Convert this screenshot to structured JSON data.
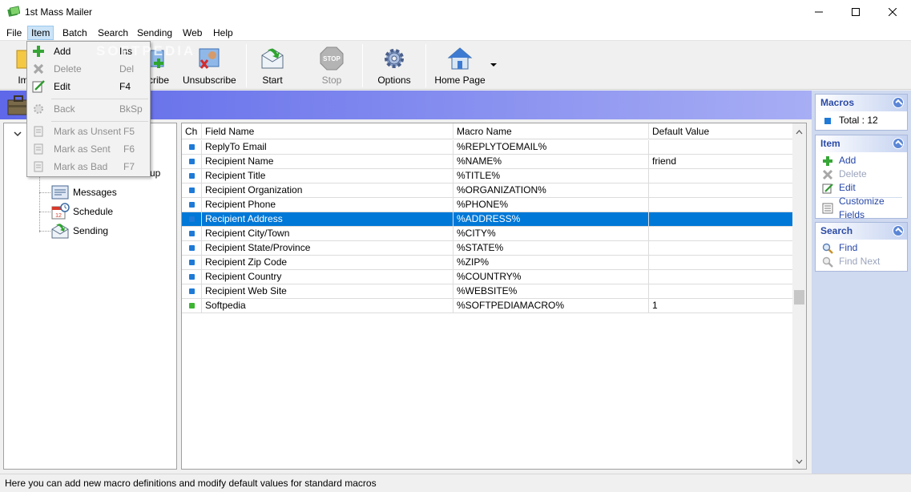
{
  "window": {
    "title": "1st Mass Mailer"
  },
  "menubar": {
    "items": [
      {
        "label": "File"
      },
      {
        "label": "Item"
      },
      {
        "label": "Batch"
      },
      {
        "label": "Search"
      },
      {
        "label": "Sending"
      },
      {
        "label": "Web"
      },
      {
        "label": "Help"
      }
    ]
  },
  "toolbar": {
    "import_label": "Im",
    "subscribe_label": "scribe",
    "unsubscribe_label": "Unsubscribe",
    "start_label": "Start",
    "stop_label": "Stop",
    "options_label": "Options",
    "homepage_label": "Home Page"
  },
  "watermark": "SOFTPEDIA",
  "item_menu": {
    "items": [
      {
        "label": "Add",
        "shortcut": "Ins",
        "icon": "add-icon",
        "enabled": true
      },
      {
        "label": "Delete",
        "shortcut": "Del",
        "icon": "delete-icon",
        "enabled": false
      },
      {
        "label": "Edit",
        "shortcut": "F4",
        "icon": "edit-icon",
        "enabled": true
      },
      {
        "label": "Back",
        "shortcut": "BkSp",
        "icon": "back-icon",
        "enabled": false
      },
      {
        "label": "Mark as Unsent",
        "shortcut": "F5",
        "icon": "mark-unsent-icon",
        "enabled": false
      },
      {
        "label": "Mark as Sent",
        "shortcut": "F6",
        "icon": "mark-sent-icon",
        "enabled": false
      },
      {
        "label": "Mark as Bad",
        "shortcut": "F7",
        "icon": "mark-bad-icon",
        "enabled": false
      }
    ]
  },
  "tree": {
    "partial_label": "up",
    "nodes": [
      {
        "label": "Messages",
        "icon": "messages-icon"
      },
      {
        "label": "Schedule",
        "icon": "schedule-icon"
      },
      {
        "label": "Sending",
        "icon": "sending-icon"
      }
    ]
  },
  "grid": {
    "columns": [
      "Ch",
      "Field Name",
      "Macro Name",
      "Default Value"
    ],
    "rows": [
      {
        "field": "ReplyTo Email",
        "macro": "%REPLYTOEMAIL%",
        "default": "",
        "mark_color": "#1e7ad6",
        "selected": false
      },
      {
        "field": "Recipient Name",
        "macro": "%NAME%",
        "default": "friend",
        "mark_color": "#1e7ad6",
        "selected": false
      },
      {
        "field": "Recipient Title",
        "macro": "%TITLE%",
        "default": "",
        "mark_color": "#1e7ad6",
        "selected": false
      },
      {
        "field": "Recipient Organization",
        "macro": "%ORGANIZATION%",
        "default": "",
        "mark_color": "#1e7ad6",
        "selected": false
      },
      {
        "field": "Recipient Phone",
        "macro": "%PHONE%",
        "default": "",
        "mark_color": "#1e7ad6",
        "selected": false
      },
      {
        "field": "Recipient Address",
        "macro": "%ADDRESS%",
        "default": "",
        "mark_color": "#1e7ad6",
        "selected": true
      },
      {
        "field": "Recipient City/Town",
        "macro": "%CITY%",
        "default": "",
        "mark_color": "#1e7ad6",
        "selected": false
      },
      {
        "field": "Recipient State/Province",
        "macro": "%STATE%",
        "default": "",
        "mark_color": "#1e7ad6",
        "selected": false
      },
      {
        "field": "Recipient Zip Code",
        "macro": "%ZIP%",
        "default": "",
        "mark_color": "#1e7ad6",
        "selected": false
      },
      {
        "field": "Recipient Country",
        "macro": "%COUNTRY%",
        "default": "",
        "mark_color": "#1e7ad6",
        "selected": false
      },
      {
        "field": "Recipient Web Site",
        "macro": "%WEBSITE%",
        "default": "",
        "mark_color": "#1e7ad6",
        "selected": false
      },
      {
        "field": "Softpedia",
        "macro": "%SOFTPEDIAMACRO%",
        "default": "1",
        "mark_color": "#3cb531",
        "selected": false
      }
    ]
  },
  "side_panel": {
    "macros": {
      "title": "Macros",
      "total": "Total : 12"
    },
    "item": {
      "title": "Item",
      "add": "Add",
      "delete": "Delete",
      "edit": "Edit",
      "customize": "Customize Fields"
    },
    "search": {
      "title": "Search",
      "find": "Find",
      "find_next": "Find Next"
    }
  },
  "status": {
    "text": "Here you can add new macro definitions and modify default values for standard macros"
  },
  "colors": {
    "selection": "#0078d7",
    "header_gradient_start": "#5e68e8",
    "side_panel_bg": "#cfd9ef",
    "side_title": "#2b4aa6"
  }
}
